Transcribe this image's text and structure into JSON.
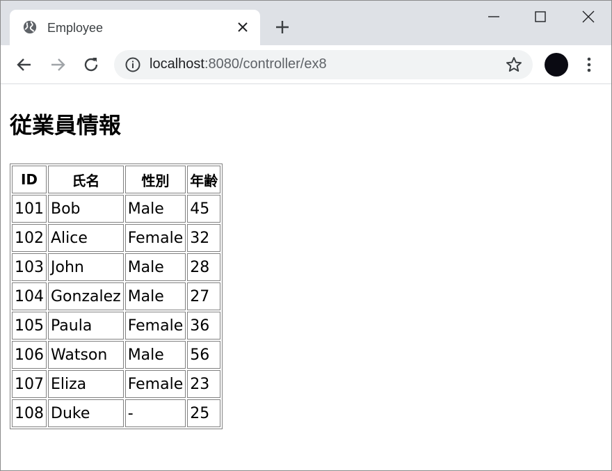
{
  "browser": {
    "tab_title": "Employee",
    "url_host": "localhost",
    "url_rest": ":8080/controller/ex8"
  },
  "page": {
    "heading": "従業員情報",
    "table": {
      "headers": [
        "ID",
        "氏名",
        "性別",
        "年齢"
      ],
      "rows": [
        [
          "101",
          "Bob",
          "Male",
          "45"
        ],
        [
          "102",
          "Alice",
          "Female",
          "32"
        ],
        [
          "103",
          "John",
          "Male",
          "28"
        ],
        [
          "104",
          "Gonzalez",
          "Male",
          "27"
        ],
        [
          "105",
          "Paula",
          "Female",
          "36"
        ],
        [
          "106",
          "Watson",
          "Male",
          "56"
        ],
        [
          "107",
          "Eliza",
          "Female",
          "23"
        ],
        [
          "108",
          "Duke",
          "-",
          "25"
        ]
      ]
    }
  }
}
